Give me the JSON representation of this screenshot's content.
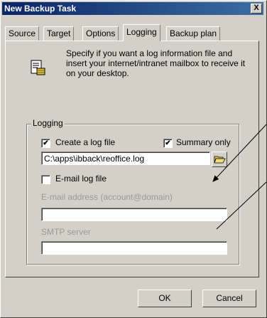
{
  "window": {
    "title": "New Backup Task",
    "close_label": "X"
  },
  "tabs": [
    {
      "label": "Source"
    },
    {
      "label": "Target"
    },
    {
      "label": "Options"
    },
    {
      "label": "Logging"
    },
    {
      "label": "Backup plan"
    }
  ],
  "active_tab": "Logging",
  "info": {
    "icon": "log-file-icon",
    "text": "Specify if you want a log information file and insert your internet/intranet mailbox to receive it on your desktop."
  },
  "logging_group": {
    "label": "Logging",
    "create_log": {
      "label": "Create a log file",
      "checked": true,
      "mark": "✔"
    },
    "summary_only": {
      "label": "Summary only",
      "checked": true,
      "mark": "✔"
    },
    "log_path": "C:\\apps\\ibback\\reoffice.log",
    "browse_icon": "folder-open-icon",
    "email_log": {
      "label": "E-mail log file",
      "checked": false,
      "mark": ""
    },
    "email_address": {
      "label": "E-mail address (account@domain)",
      "value": ""
    },
    "smtp_server": {
      "label": "SMTP server",
      "value": ""
    }
  },
  "buttons": {
    "ok": "OK",
    "cancel": "Cancel"
  }
}
